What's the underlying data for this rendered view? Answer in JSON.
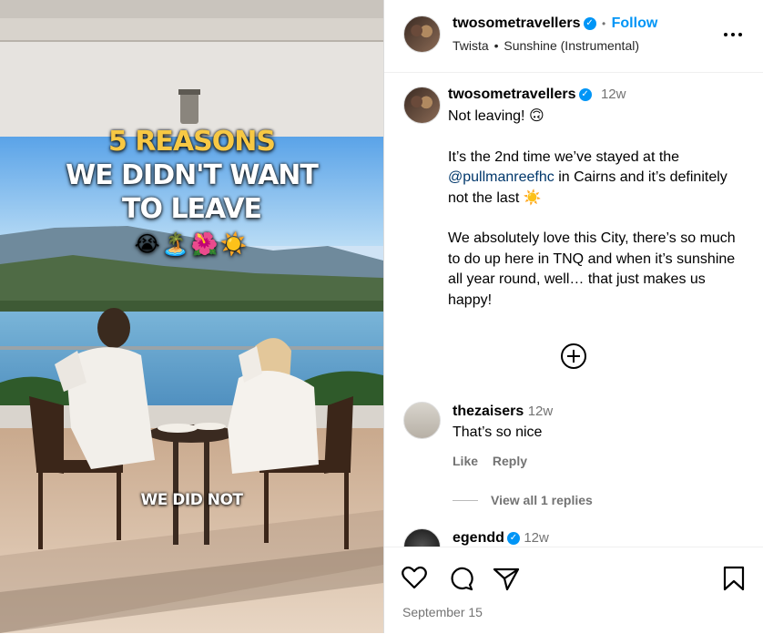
{
  "video": {
    "headline_line1": "5 REASONS",
    "headline_line2": "WE DIDN'T WANT",
    "headline_line3": "TO LEAVE",
    "emojis": "😭🏝️🌺☀️",
    "subtitle": "WE DID NOT"
  },
  "header": {
    "username": "twosometravellers",
    "separator": "•",
    "follow_label": "Follow",
    "audio_artist": "Twista",
    "audio_dot": "•",
    "audio_track": "Sunshine (Instrumental)",
    "more_icon": "more-horizontal-icon"
  },
  "caption": {
    "username": "twosometravellers",
    "age": "12w",
    "line1": "Not leaving! 🙃",
    "para2_a": "It’s the 2nd time we’ve stayed at the ",
    "mention": "@pullmanreefhc",
    "para2_b": " in Cairns and it’s definitely not the last ☀️",
    "para3": "We absolutely love this City, there’s so much to do up here in TNQ and when it’s sunshine all year round, well… that just makes us happy!"
  },
  "load_more_icon": "plus-circle-icon",
  "comments": [
    {
      "username": "thezaisers",
      "age": "12w",
      "text": "That’s so nice",
      "like_label": "Like",
      "reply_label": "Reply",
      "view_replies": "View all 1 replies"
    },
    {
      "username": "egendd",
      "age": "12w"
    }
  ],
  "actions": {
    "like_icon": "heart-icon",
    "comment_icon": "comment-icon",
    "share_icon": "share-icon",
    "save_icon": "bookmark-icon",
    "date": "September 15"
  },
  "colors": {
    "link_blue": "#0095f6",
    "mention_blue": "#00376b",
    "headline_yellow": "#f7c844",
    "muted_gray": "#737373"
  }
}
